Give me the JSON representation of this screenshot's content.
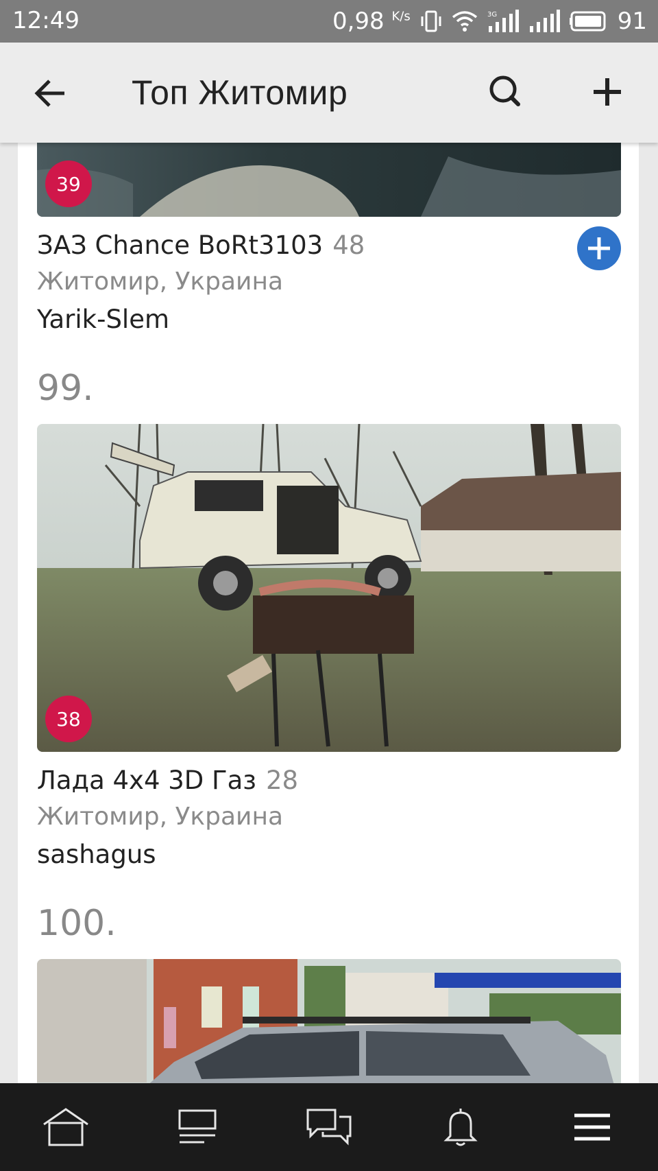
{
  "status": {
    "time": "12:49",
    "speed": "0,98",
    "speed_unit": "K/s",
    "battery": "91"
  },
  "appbar": {
    "title": "Топ Житомир"
  },
  "items": [
    {
      "rank": "",
      "badge": "39",
      "title": "ЗАЗ Chance BoRt3103",
      "count": "48",
      "location": "Житомир, Украина",
      "owner": "Yarik-Slem",
      "follow": true
    },
    {
      "rank": "99.",
      "badge": "38",
      "title": "Лада 4x4 3D Газ",
      "count": "28",
      "location": "Житомир, Украина",
      "owner": "sashagus",
      "follow": false
    },
    {
      "rank": "100.",
      "badge": "",
      "title": "",
      "count": "",
      "location": "",
      "owner": "",
      "follow": false
    }
  ],
  "navbar": {
    "icons": [
      "home-icon",
      "feed-icon",
      "messages-icon",
      "notifications-icon",
      "menu-icon"
    ]
  }
}
